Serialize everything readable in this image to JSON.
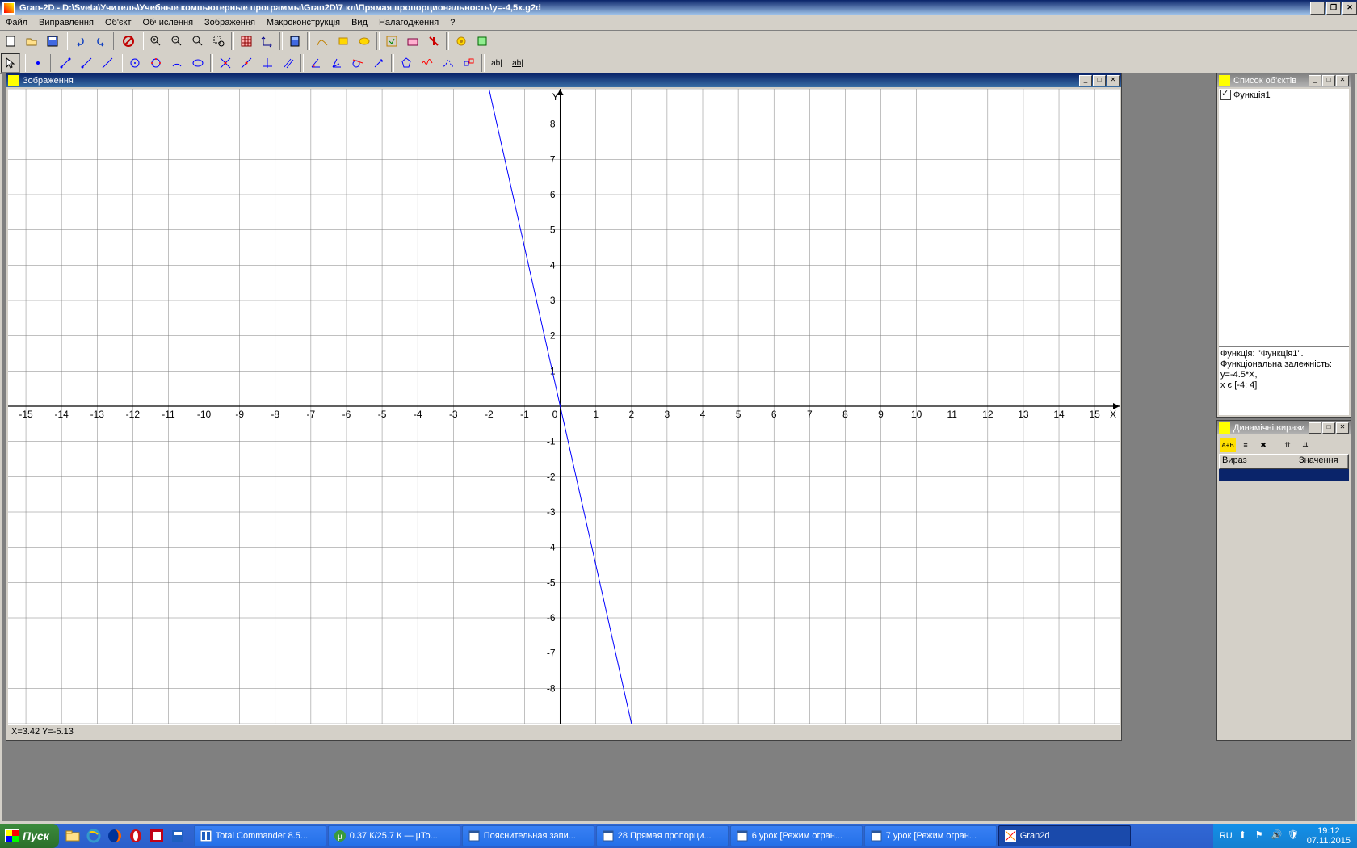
{
  "window": {
    "title": "Gran-2D - D:\\Sveta\\Учитель\\Учебные компьютерные программы\\Gran2D\\7 кл\\Прямая пропорциональность\\y=-4,5x.g2d"
  },
  "menu": [
    "Файл",
    "Виправлення",
    "Об'єкт",
    "Обчислення",
    "Зображення",
    "Макроконструкція",
    "Вид",
    "Налагодження",
    "?"
  ],
  "panels": {
    "graph": {
      "title": "Зображення",
      "status": "X=3.42 Y=-5.13"
    },
    "objects": {
      "title": "Список об'єктів",
      "items": [
        {
          "name": "Функція1",
          "checked": true
        }
      ],
      "desc_l1": "Функція: ''Функція1''.",
      "desc_l2": "Функціональна залежність:",
      "desc_l3": "y=-4.5*X,",
      "desc_l4": "x є [-4; 4]"
    },
    "dynamic": {
      "title": "Динамічні вирази",
      "col1": "Вираз",
      "col2": "Значення"
    }
  },
  "chart_data": {
    "type": "line",
    "title": "",
    "xlabel": "X",
    "ylabel": "Y",
    "xlim": [
      -15.5,
      15.7
    ],
    "ylim": [
      -9,
      9
    ],
    "series": [
      {
        "name": "Функція1",
        "x": [
          -2,
          2
        ],
        "y": [
          9,
          -9
        ]
      }
    ],
    "xticks": [
      -15,
      -14,
      -13,
      -12,
      -11,
      -10,
      -9,
      -8,
      -7,
      -6,
      -5,
      -4,
      -3,
      -2,
      -1,
      0,
      1,
      2,
      3,
      4,
      5,
      6,
      7,
      8,
      9,
      10,
      11,
      12,
      13,
      14,
      15
    ],
    "yticks": [
      -8,
      -7,
      -6,
      -5,
      -4,
      -3,
      -2,
      -1,
      1,
      2,
      3,
      4,
      5,
      6,
      7,
      8
    ]
  },
  "taskbar": {
    "start": "Пуск",
    "tasks": [
      {
        "label": "Total Commander 8.5...",
        "icon": "tc"
      },
      {
        "label": "0.37 К/25.7 К — µTo...",
        "icon": "ut"
      },
      {
        "label": "Пояснительная запи...",
        "icon": "wd"
      },
      {
        "label": "28 Прямая пропорци...",
        "icon": "wd"
      },
      {
        "label": "6 урок [Режим огран...",
        "icon": "wd"
      },
      {
        "label": "7 урок [Режим огран...",
        "icon": "wd"
      },
      {
        "label": "Gran2d",
        "icon": "g2",
        "active": true
      }
    ],
    "lang": "RU",
    "time": "19:12",
    "date": "07.11.2015"
  }
}
